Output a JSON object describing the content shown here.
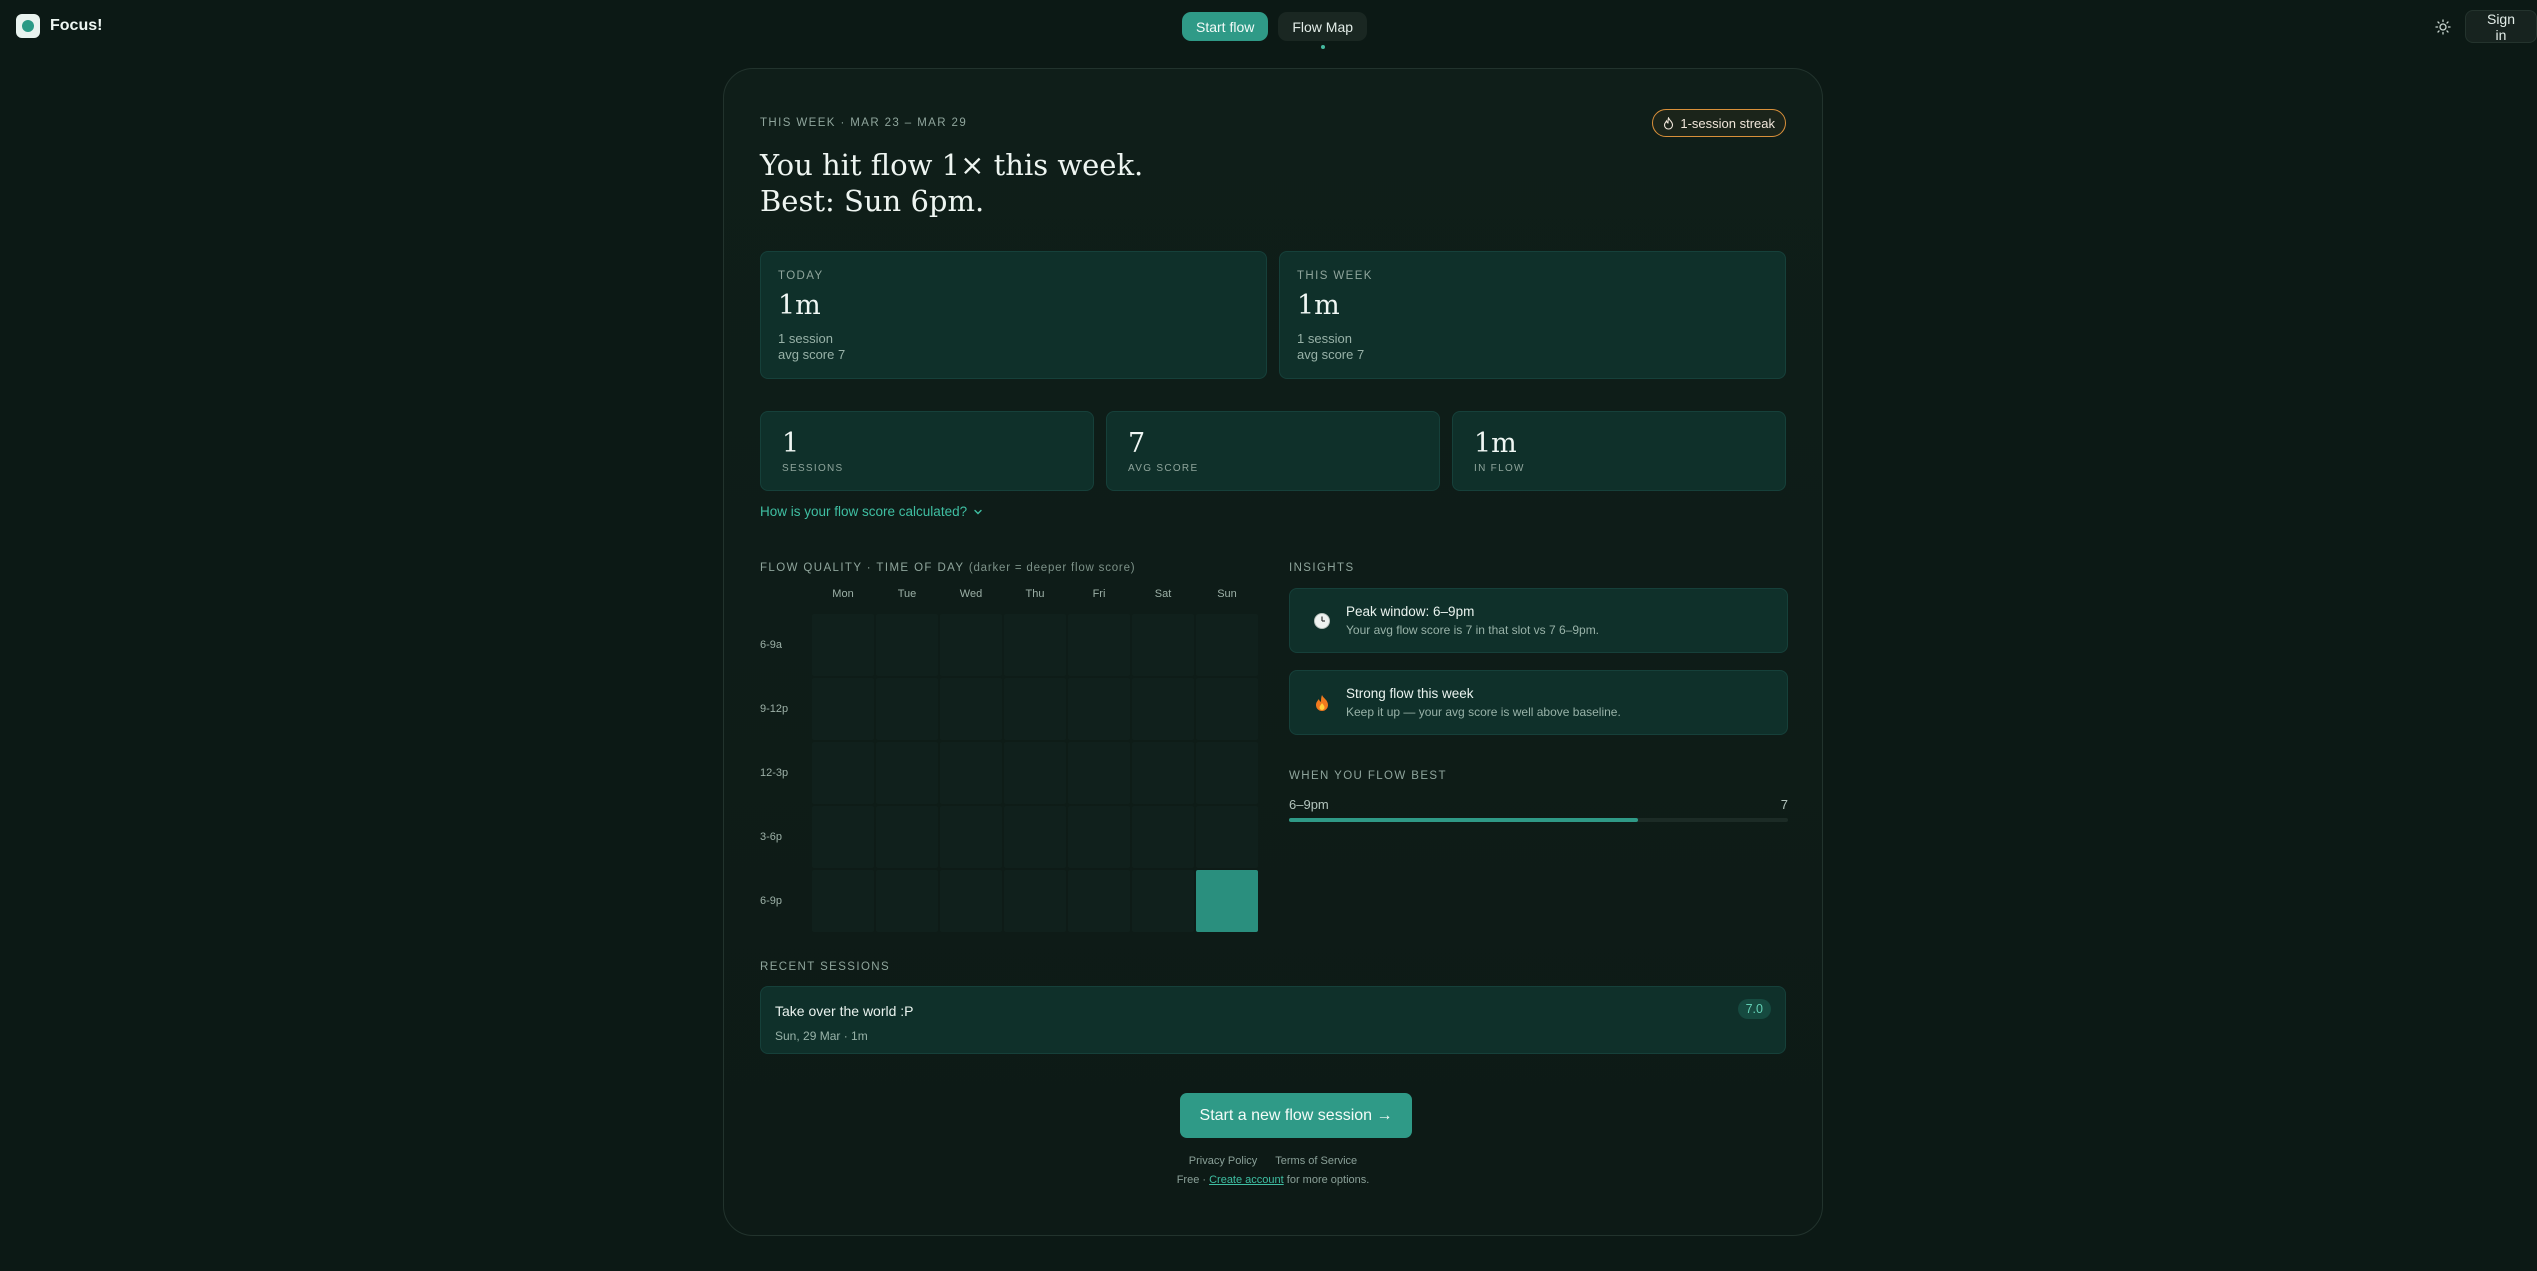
{
  "brand": {
    "name": "Focus!"
  },
  "nav": {
    "start_flow": "Start flow",
    "flow_map": "Flow Map"
  },
  "header": {
    "sign_in": "Sign in"
  },
  "week": {
    "label": "THIS WEEK · MAR 23 – MAR 29",
    "streak": "1-session streak",
    "headline_line1": "You hit flow 1× this week.",
    "headline_line2": "Best: Sun 6pm."
  },
  "summary": [
    {
      "label": "TODAY",
      "value": "1m",
      "sessions": "1 session",
      "avg": "avg score 7"
    },
    {
      "label": "THIS WEEK",
      "value": "1m",
      "sessions": "1 session",
      "avg": "avg score 7"
    }
  ],
  "metrics": [
    {
      "value": "1",
      "label": "SESSIONS"
    },
    {
      "value": "7",
      "label": "AVG SCORE"
    },
    {
      "value": "1m",
      "label": "IN FLOW"
    }
  ],
  "score_link": "How is your flow score calculated?",
  "heatmap": {
    "title": "FLOW QUALITY · TIME OF DAY",
    "hint": "(darker = deeper flow score)",
    "days": [
      "Mon",
      "Tue",
      "Wed",
      "Thu",
      "Fri",
      "Sat",
      "Sun"
    ],
    "slots": [
      "6-9a",
      "9-12p",
      "12-3p",
      "3-6p",
      "6-9p"
    ],
    "values": [
      [
        0,
        0,
        0,
        0,
        0,
        0,
        0
      ],
      [
        0,
        0,
        0,
        0,
        0,
        0,
        0
      ],
      [
        0,
        0,
        0,
        0,
        0,
        0,
        0
      ],
      [
        0,
        0,
        0,
        0,
        0,
        0,
        0
      ],
      [
        0,
        0,
        0,
        0,
        0,
        0,
        7
      ]
    ]
  },
  "insights": {
    "title": "INSIGHTS",
    "items": [
      {
        "icon": "clock-icon",
        "title": "Peak window: 6–9pm",
        "text": "Your avg flow score is 7 in that slot vs 7 6–9pm."
      },
      {
        "icon": "fire-icon",
        "title": "Strong flow this week",
        "text": "Keep it up — your avg score is well above baseline."
      }
    ]
  },
  "best": {
    "title": "WHEN YOU FLOW BEST",
    "slot": "6–9pm",
    "score": "7",
    "fraction": 0.7
  },
  "recent": {
    "title": "RECENT SESSIONS",
    "sessions": [
      {
        "name": "Take over the world :P",
        "meta": "Sun, 29 Mar · 1m",
        "score": "7.0"
      }
    ]
  },
  "cta": "Start a new flow session →",
  "footer": {
    "privacy": "Privacy Policy",
    "terms": "Terms of Service",
    "note_prefix": "Free ·",
    "create_account": "Create account",
    "note_suffix": "for more options."
  },
  "colors": {
    "accent": "#2f9a87",
    "streak_border": "#d9903a",
    "background": "#0c1915"
  }
}
